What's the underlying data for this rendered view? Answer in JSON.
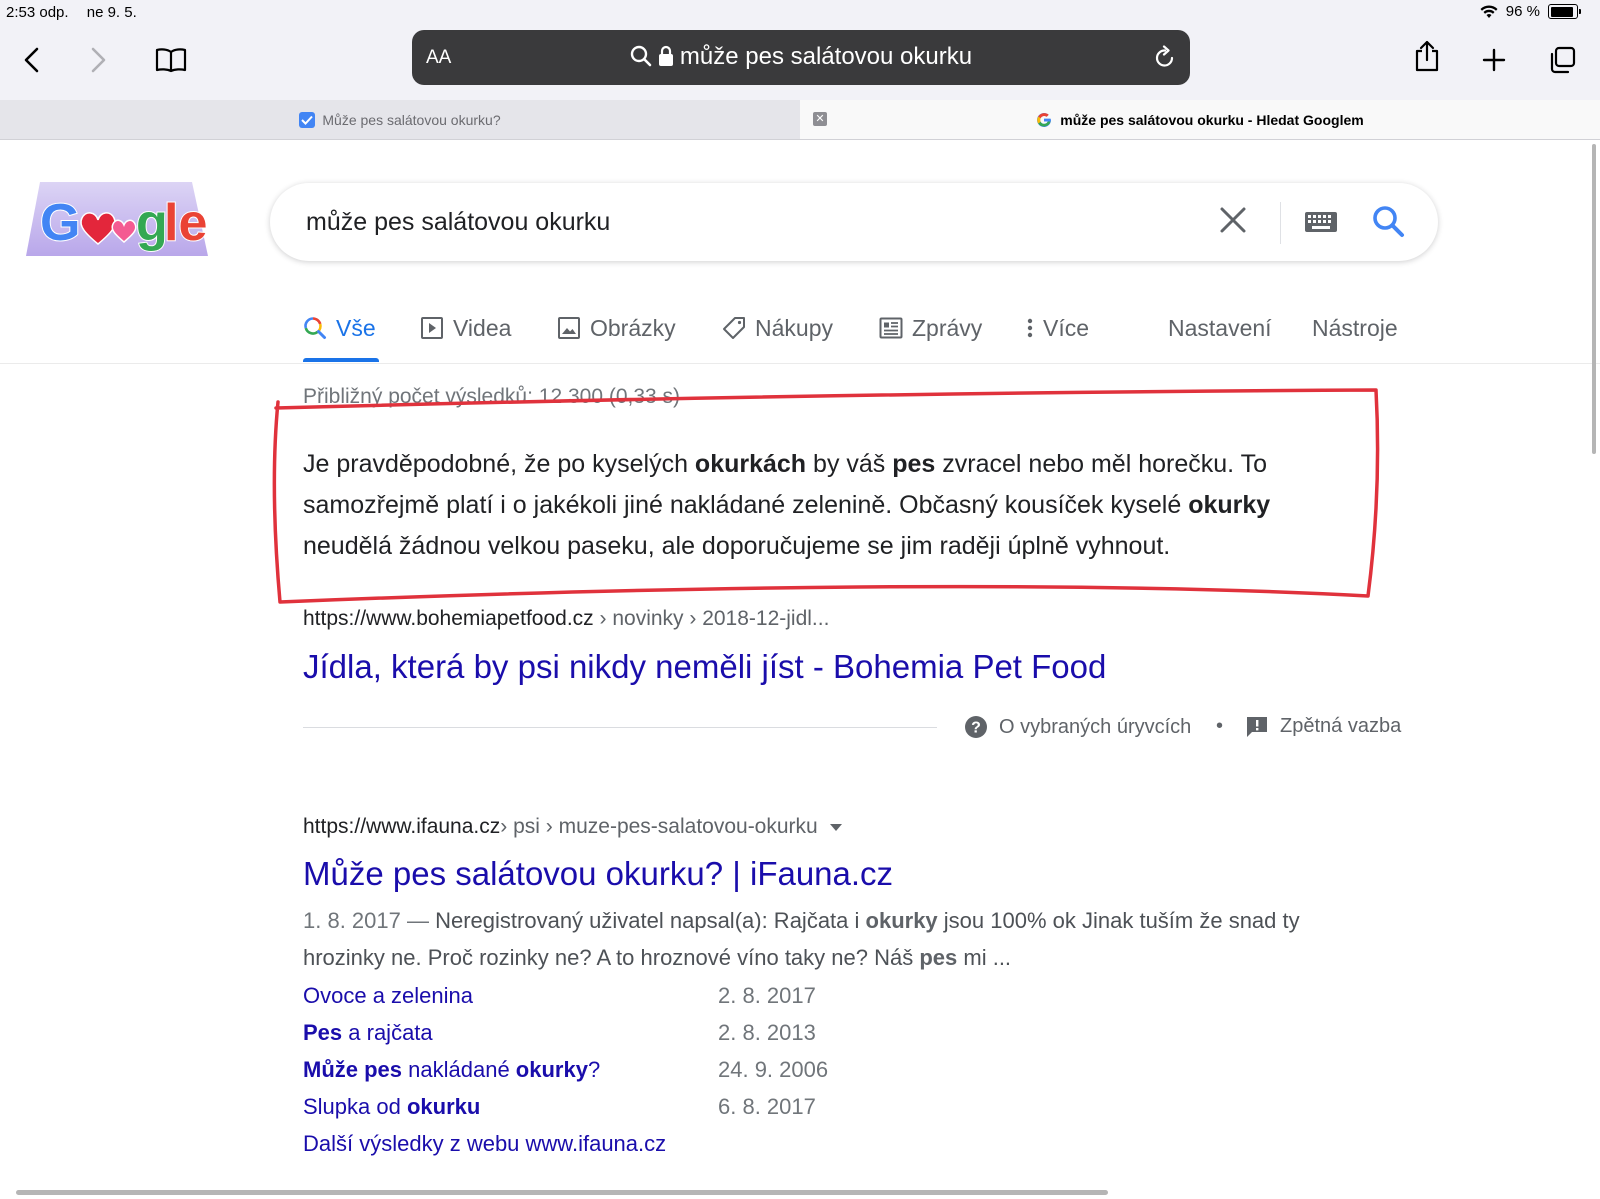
{
  "status_bar": {
    "time": "2:53 odp.",
    "date": "ne 9. 5.",
    "battery": "96 %"
  },
  "browser": {
    "address_text_size": "AA",
    "address": "může pes salátovou okurku",
    "tabs": [
      {
        "title": "Může pes salátovou okurku?",
        "active": false
      },
      {
        "title": "může pes salátovou okurku - Hledat Googlem",
        "active": true
      }
    ]
  },
  "search": {
    "query": "může pes salátovou okurku"
  },
  "nav": {
    "items": [
      {
        "label": "Vše",
        "active": true
      },
      {
        "label": "Videa"
      },
      {
        "label": "Obrázky"
      },
      {
        "label": "Nákupy"
      },
      {
        "label": "Zprávy"
      },
      {
        "label": "Více"
      }
    ],
    "settings": "Nastavení",
    "tools": "Nástroje"
  },
  "results_stats": "Přibližný počet výsledků: 12 300 (0,33 s)",
  "featured_snippet": {
    "parts": [
      "Je pravděpodobné, že po kyselých ",
      "okurkách",
      " by váš ",
      "pes",
      " zvracel nebo měl horečku. To samozřejmě platí i o jakékoli jiné nakládané zelenině. Občasný kousíček kyselé ",
      "okurky",
      " neudělá žádnou velkou paseku, ale doporučujeme se jim raději úplně vyhnout."
    ],
    "cite_domain": "https://www.bohemiapetfood.cz",
    "cite_path": " › novinky › 2018-12-jidl...",
    "title": "Jídla, která by psi nikdy neměli jíst - Bohemia Pet Food",
    "about": "O vybraných úryvcích",
    "separator": "•",
    "feedback": "Zpětná vazba"
  },
  "result2": {
    "cite_domain": "https://www.ifauna.cz",
    "cite_path": " › psi › muze-pes-salatovou-okurku",
    "title": "Může pes salátovou okurku? | iFauna.cz",
    "date": "1. 8. 2017 —",
    "desc_parts": [
      " Neregistrovaný uživatel napsal(a): Rajčata i ",
      "okurky",
      " jsou 100% ok Jinak tuším že snad ty hrozinky ne. Proč rozinky ne? A to hroznové víno taky ne? Náš ",
      "pes",
      " mi ..."
    ],
    "sublinks": [
      {
        "parts": [
          "Ovoce a zelenina"
        ],
        "date": "2. 8. 2017"
      },
      {
        "parts": [
          "Pes",
          " a rajčata"
        ],
        "date": "2. 8. 2013"
      },
      {
        "parts": [
          "Může pes",
          " nakládané ",
          "okurky",
          "?"
        ],
        "date": "24. 9. 2006"
      },
      {
        "parts": [
          "Slupka od ",
          "okurku"
        ],
        "date": "6. 8. 2017"
      }
    ],
    "more": "Další výsledky z webu www.ifauna.cz"
  },
  "colors": {
    "link": "#1a0dab",
    "accent": "#1a73e8",
    "annotation": "#e0323c"
  },
  "icons": [
    "back-icon",
    "forward-icon",
    "bookmarks-icon",
    "search-icon",
    "lock-icon",
    "reload-icon",
    "share-icon",
    "new-tab-icon",
    "tabs-overview-icon",
    "clear-icon",
    "keyboard-icon",
    "help-icon",
    "feedback-icon"
  ]
}
